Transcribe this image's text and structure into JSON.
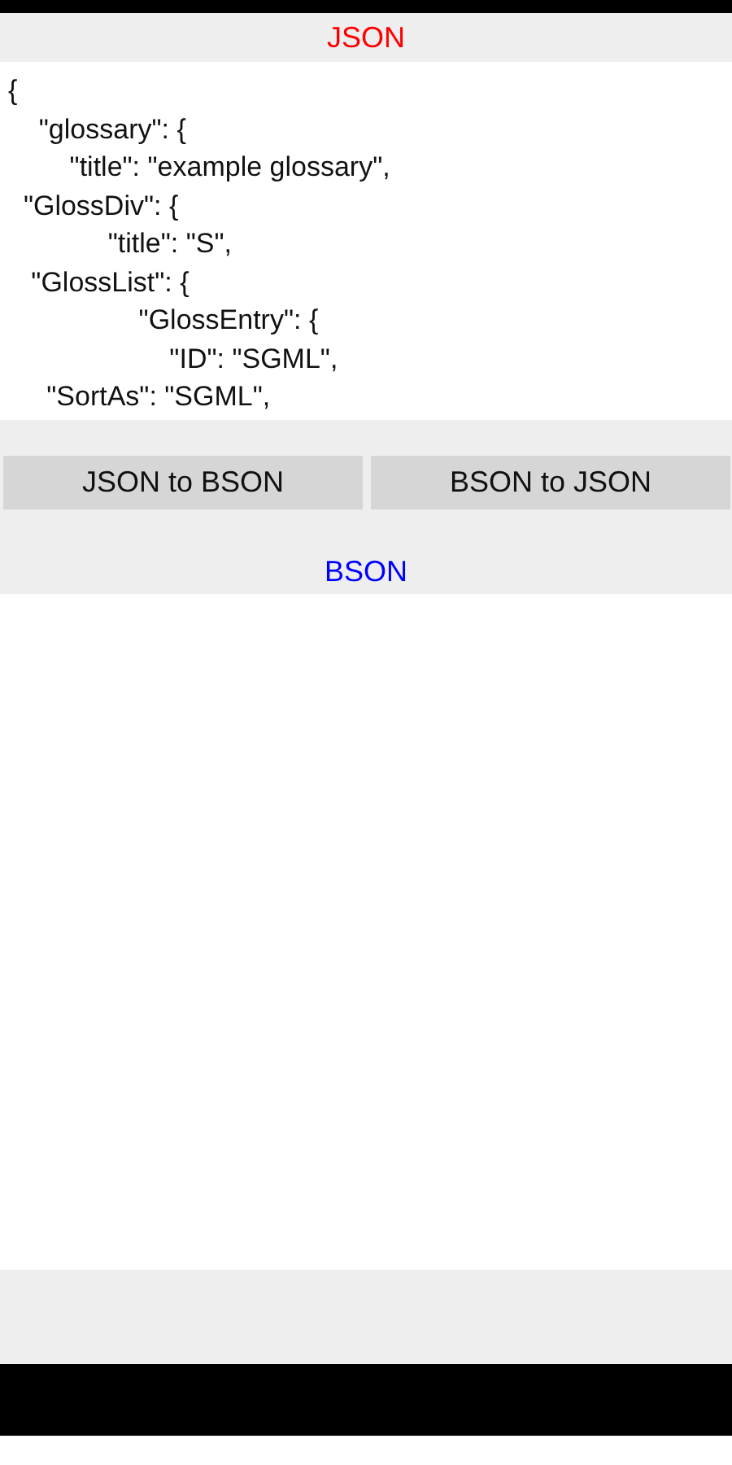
{
  "json_panel": {
    "title": "JSON",
    "value": "{\n    \"glossary\": {\n        \"title\": \"example glossary\",\n  \"GlossDiv\": {\n             \"title\": \"S\",\n   \"GlossList\": {\n                 \"GlossEntry\": {\n                     \"ID\": \"SGML\",\n     \"SortAs\": \"SGML\","
  },
  "buttons": [
    {
      "label": "JSON to BSON"
    },
    {
      "label": "BSON to JSON"
    }
  ],
  "bson_panel": {
    "title": "BSON"
  }
}
